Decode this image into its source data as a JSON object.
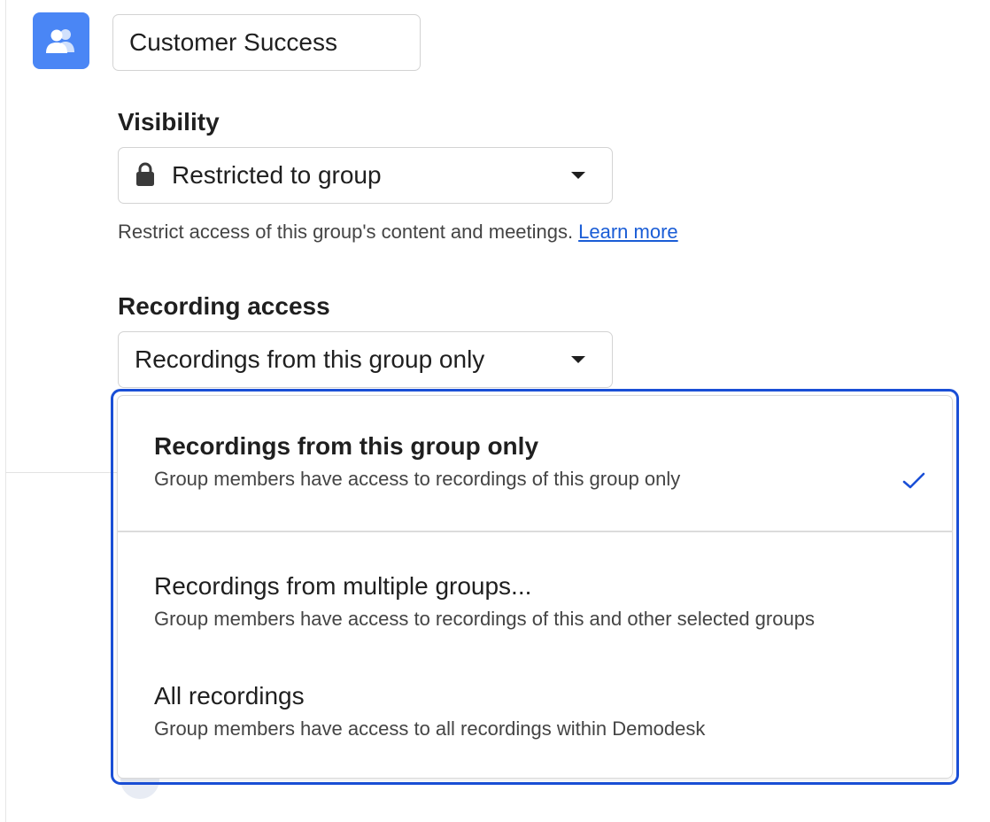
{
  "group": {
    "name_value": "Customer Success",
    "avatar_icon": "users-icon",
    "avatar_color": "#4a86f5"
  },
  "visibility": {
    "label": "Visibility",
    "selected": "Restricted to group",
    "icon": "lock-icon",
    "helper_text": "Restrict access of this group's content and meetings.",
    "learn_more": "Learn more"
  },
  "recording_access": {
    "label": "Recording access",
    "selected": "Recordings from this group only",
    "options": [
      {
        "title": "Recordings from this group only",
        "description": "Group members have access to recordings of this group only",
        "selected": true
      },
      {
        "title": "Recordings from multiple groups...",
        "description": "Group members have access to recordings of this and other selected groups",
        "selected": false
      },
      {
        "title": "All recordings",
        "description": "Group members have access to all recordings within Demodesk",
        "selected": false
      }
    ]
  },
  "colors": {
    "accent": "#1a4fd6",
    "link": "#1a5dd6"
  }
}
